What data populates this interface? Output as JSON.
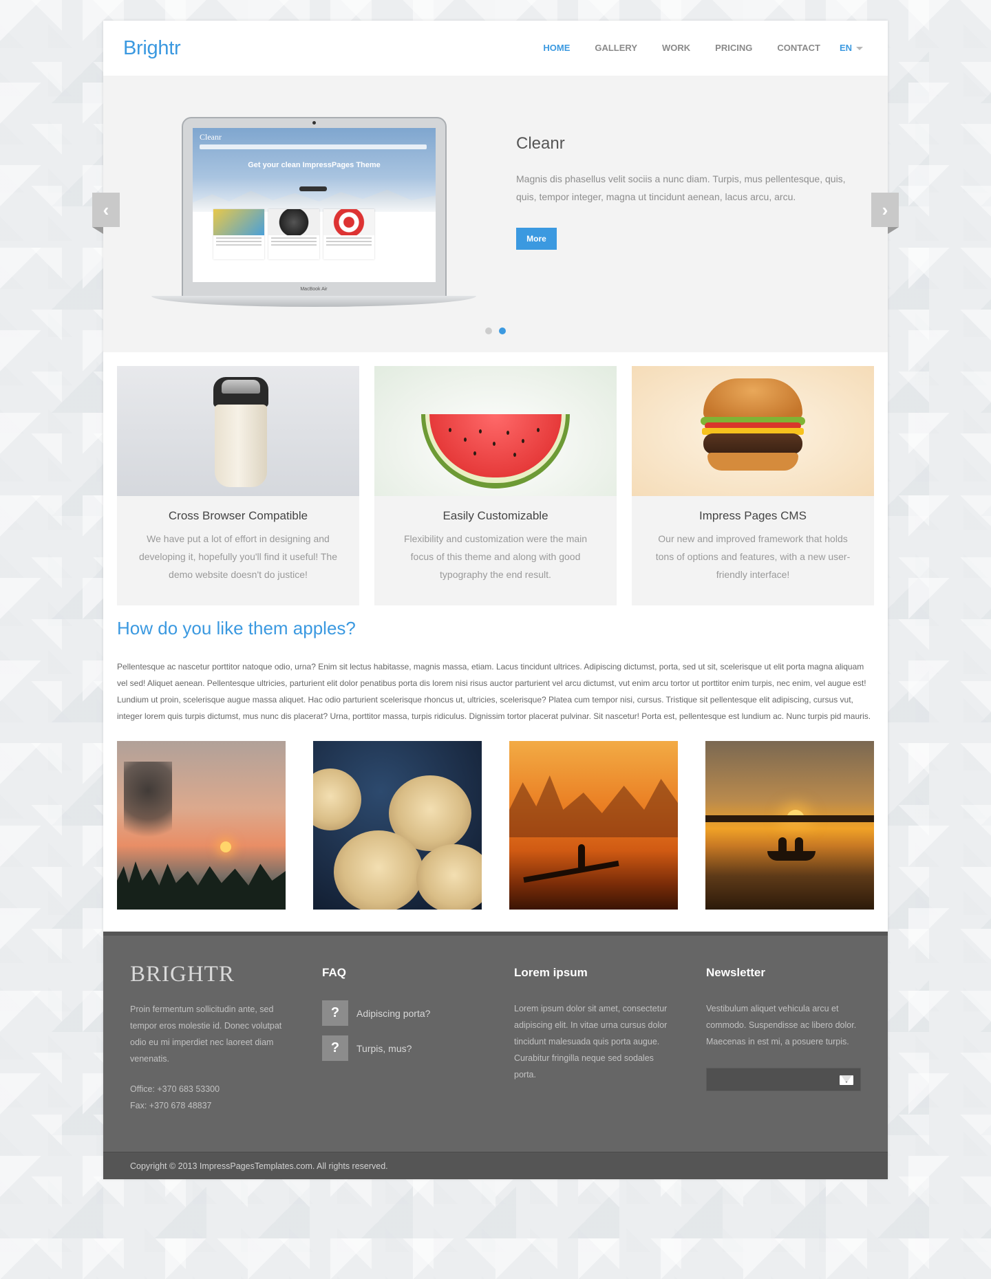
{
  "brand": "Brightr",
  "nav": {
    "items": [
      "HOME",
      "GALLERY",
      "WORK",
      "PRICING",
      "CONTACT"
    ],
    "active": "HOME",
    "language": "EN"
  },
  "slider": {
    "title": "Cleanr",
    "description": "Magnis dis phasellus velit sociis a nunc diam. Turpis, mus pellentesque, quis, quis, tempor integer, magna ut tincidunt aenean, lacus arcu, arcu.",
    "button": "More",
    "slide_count": 2,
    "active_slide": 2,
    "screen": {
      "title": "Cleanr",
      "headline": "Get your clean ImpressPages Theme",
      "laptop_label": "MacBook Air"
    }
  },
  "features": [
    {
      "title": "Cross Browser Compatible",
      "text": "We have put a lot of effort in designing and developing it, hopefully you'll find it useful! The demo website doesn't do justice!"
    },
    {
      "title": "Easily Customizable",
      "text": "Flexibility and customization were the main focus of this theme and along with good typography the end result."
    },
    {
      "title": "Impress Pages CMS",
      "text": "Our new and improved framework that holds tons of options and features, with a new user-friendly interface!"
    }
  ],
  "intro": {
    "heading": "How do you like them apples?",
    "body": "Pellentesque ac nascetur porttitor natoque odio, urna? Enim sit lectus habitasse, magnis massa, etiam. Lacus tincidunt ultrices. Adipiscing dictumst, porta, sed ut sit, scelerisque ut elit porta magna aliquam vel sed! Aliquet aenean. Pellentesque ultricies, parturient elit dolor penatibus porta dis lorem nisi risus auctor parturient vel arcu dictumst, vut enim arcu tortor ut porttitor enim turpis, nec enim, vel augue est! Lundium ut proin, scelerisque augue massa aliquet. Hac odio parturient scelerisque rhoncus ut, ultricies, scelerisque? Platea cum tempor nisi, cursus. Tristique sit pellentesque elit adipiscing, cursus vut, integer lorem quis turpis dictumst, mus nunc dis placerat? Urna, porttitor massa, turpis ridiculus. Dignissim tortor placerat pulvinar. Sit nascetur! Porta est, pellentesque est lundium ac. Nunc turpis pid mauris."
  },
  "footer": {
    "logo": "BRIGHTR",
    "about": "Proin fermentum sollicitudin ante, sed tempor eros molestie id. Donec volutpat odio eu mi imperdiet nec laoreet diam venenatis.",
    "office": "Office: +370 683 53300",
    "fax": "Fax: +370 678 48837",
    "faq_title": "FAQ",
    "faq_icon": "?",
    "faq": [
      "Adipiscing porta?",
      "Turpis, mus?"
    ],
    "lorem_title": "Lorem ipsum",
    "lorem_text": "Lorem ipsum dolor sit amet, consectetur adipiscing elit. In vitae urna cursus dolor tincidunt malesuada quis porta augue. Curabitur fringilla neque sed sodales porta.",
    "newsletter_title": "Newsletter",
    "newsletter_text": "Vestibulum aliquet vehicula arcu et commodo. Suspendisse ac libero dolor. Maecenas in est mi, a posuere turpis.",
    "newsletter_placeholder": "",
    "copyright": "Copyright © 2013 ImpressPagesTemplates.com. All rights reserved."
  },
  "colors": {
    "accent": "#3b99e0",
    "footer_bg": "#666666",
    "copyright_bg": "#555555"
  }
}
